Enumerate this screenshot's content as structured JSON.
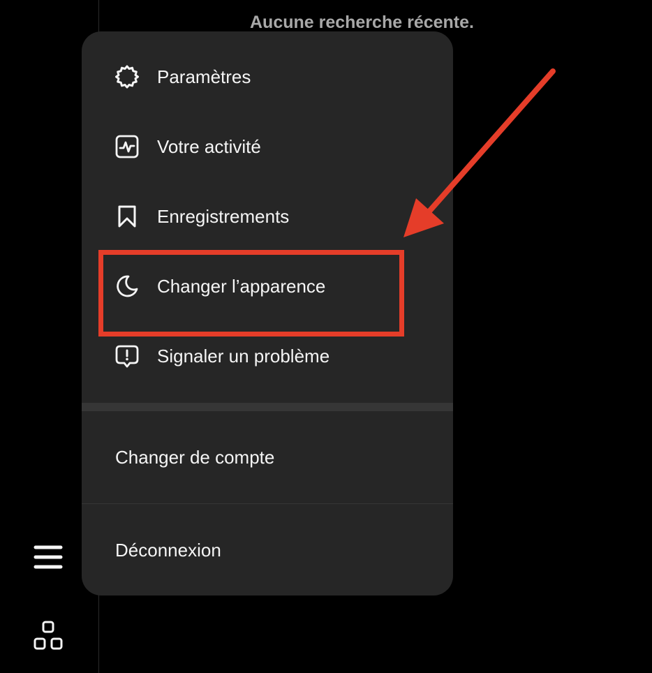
{
  "search": {
    "empty_text": "Aucune recherche récente."
  },
  "menu": {
    "items": [
      {
        "label": "Paramètres",
        "icon": "gear-icon"
      },
      {
        "label": "Votre activité",
        "icon": "activity-icon"
      },
      {
        "label": "Enregistrements",
        "icon": "bookmark-icon"
      },
      {
        "label": "Changer l’apparence",
        "icon": "moon-icon"
      },
      {
        "label": "Signaler un problème",
        "icon": "report-problem-icon"
      }
    ],
    "switch_account": "Changer de compte",
    "logout": "Déconnexion"
  },
  "sidebar": {
    "icons": [
      "menu-icon",
      "more-apps-icon"
    ]
  },
  "colors": {
    "background": "#000000",
    "menu_background": "#262626",
    "text": "#f5f5f5",
    "muted_text": "#a8a8a8",
    "annotation": "#e53d29"
  }
}
